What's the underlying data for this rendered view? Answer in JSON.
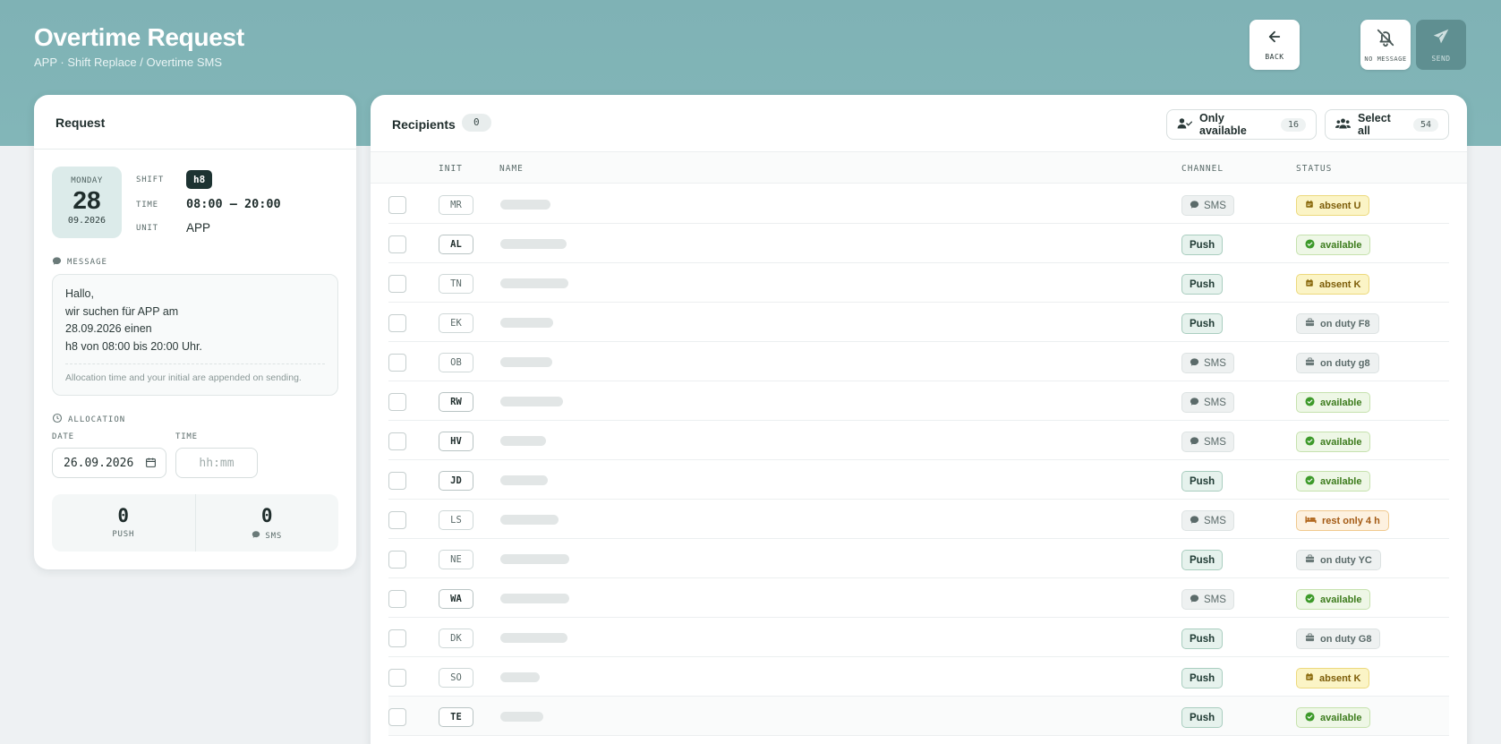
{
  "header": {
    "title": "Overtime Request",
    "subtitle": "APP · Shift Replace / Overtime SMS",
    "back_label": "BACK",
    "no_message_label": "NO MESSAGE",
    "send_label": "SEND"
  },
  "request": {
    "title": "Request",
    "weekday": "MONDAY",
    "day": "28",
    "month_year": "09.2026",
    "shift_key": "SHIFT",
    "shift_value": "h8",
    "time_key": "TIME",
    "time_value": "08:00 – 20:00",
    "unit_key": "UNIT",
    "unit_value": "APP",
    "message_label": "MESSAGE",
    "message_lines": [
      "Hallo,",
      "wir suchen für APP am",
      "28.09.2026 einen",
      "h8 von 08:00 bis 20:00 Uhr."
    ],
    "message_note": "Allocation time and your initial are appended on sending.",
    "allocation_label": "ALLOCATION",
    "date_label": "DATE",
    "date_value": "26.09.2026",
    "time_label": "TIME",
    "time_placeholder": "hh:mm",
    "push_count": "0",
    "push_label": "PUSH",
    "sms_count": "0",
    "sms_label": "SMS"
  },
  "recipients": {
    "title": "Recipients",
    "selected_count": "0",
    "only_available_label": "Only available",
    "only_available_count": "16",
    "select_all_label": "Select all",
    "select_all_count": "54",
    "columns": {
      "init": "INIT",
      "name": "NAME",
      "channel": "CHANNEL",
      "status": "STATUS"
    },
    "rows": [
      {
        "init": "MR",
        "emph": false,
        "channel": "SMS",
        "status": "absent U",
        "status_type": "absent"
      },
      {
        "init": "AL",
        "emph": true,
        "channel": "Push",
        "status": "available",
        "status_type": "available"
      },
      {
        "init": "TN",
        "emph": false,
        "channel": "Push",
        "status": "absent K",
        "status_type": "absent"
      },
      {
        "init": "EK",
        "emph": false,
        "channel": "Push",
        "status": "on duty F8",
        "status_type": "onduty"
      },
      {
        "init": "OB",
        "emph": false,
        "channel": "SMS",
        "status": "on duty g8",
        "status_type": "onduty"
      },
      {
        "init": "RW",
        "emph": true,
        "channel": "SMS",
        "status": "available",
        "status_type": "available"
      },
      {
        "init": "HV",
        "emph": true,
        "channel": "SMS",
        "status": "available",
        "status_type": "available"
      },
      {
        "init": "JD",
        "emph": true,
        "channel": "Push",
        "status": "available",
        "status_type": "available"
      },
      {
        "init": "LS",
        "emph": false,
        "channel": "SMS",
        "status": "rest only 4 h",
        "status_type": "rest"
      },
      {
        "init": "NE",
        "emph": false,
        "channel": "Push",
        "status": "on duty YC",
        "status_type": "onduty"
      },
      {
        "init": "WA",
        "emph": true,
        "channel": "SMS",
        "status": "available",
        "status_type": "available"
      },
      {
        "init": "DK",
        "emph": false,
        "channel": "Push",
        "status": "on duty G8",
        "status_type": "onduty"
      },
      {
        "init": "SO",
        "emph": false,
        "channel": "Push",
        "status": "absent K",
        "status_type": "absent"
      },
      {
        "init": "TE",
        "emph": true,
        "channel": "Push",
        "status": "available",
        "status_type": "available"
      }
    ]
  }
}
